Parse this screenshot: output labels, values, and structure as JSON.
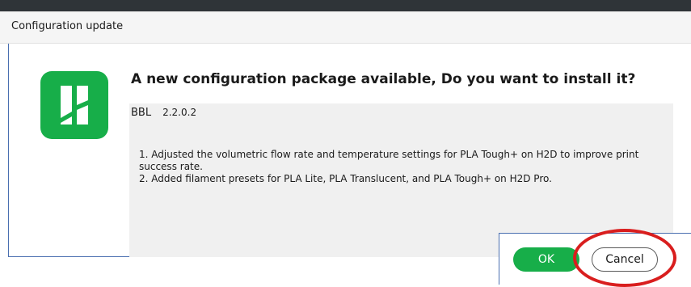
{
  "window": {
    "title": "Configuration update"
  },
  "icon": {
    "name": "bambu-studio-icon",
    "color": "#17ae49"
  },
  "content": {
    "heading": "A new configuration package available, Do you want to install it?",
    "package_name": "BBL",
    "package_version": "2.2.0.2",
    "notes": [
      "1. Adjusted the volumetric flow rate and temperature settings for PLA Tough+ on H2D to improve print success rate.",
      "2. Added filament presets for PLA Lite, PLA Translucent, and PLA Tough+ on H2D Pro."
    ]
  },
  "buttons": {
    "ok_label": "OK",
    "cancel_label": "Cancel"
  },
  "colors": {
    "accent": "#17ae49",
    "highlight": "#d91e1e"
  }
}
